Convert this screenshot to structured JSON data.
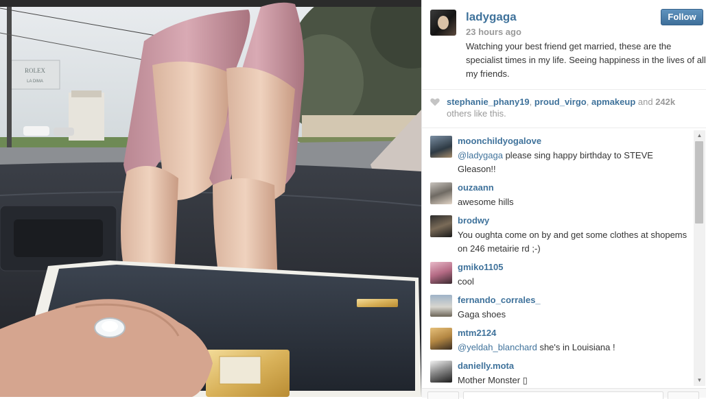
{
  "post": {
    "username": "ladygaga",
    "follow_label": "Follow",
    "timestamp": "23 hours ago",
    "caption": "Watching your best friend get married, these are the specialist times in my life. Seeing happiness in the lives of all my friends."
  },
  "likes": {
    "users": [
      "stephanie_phany19",
      "proud_virgo",
      "apmakeup"
    ],
    "sep1": ", ",
    "sep2": ", ",
    "and_text": " and ",
    "count": "242k",
    "suffix": " others like this."
  },
  "comments": [
    {
      "user": "moonchildyogalove",
      "mention": "@ladygaga",
      "text": " please sing happy birthday to STEVE Gleason!!"
    },
    {
      "user": "ouzaann",
      "mention": "",
      "text": "awesome hills"
    },
    {
      "user": "brodwy",
      "mention": "",
      "text": "You oughta come on by and get some clothes at shopems on 246 metairie rd ;-)"
    },
    {
      "user": "gmiko1105",
      "mention": "",
      "text": "cool"
    },
    {
      "user": "fernando_corrales_",
      "mention": "",
      "text": "Gaga shoes"
    },
    {
      "user": "mtm2124",
      "mention": "@yeldah_blanchard",
      "text": " she's in Louisiana !"
    },
    {
      "user": "danielly.mota",
      "mention": "",
      "text": "Mother Monster ▯"
    }
  ],
  "photo": {
    "sign_text": "ROLEX",
    "sign_subtext": "LA DIMA"
  },
  "colors": {
    "link": "#3f729b",
    "follow_button": "#4b7eab",
    "muted": "#999999"
  },
  "icons": {
    "like": "heart-icon",
    "scroll_up": "scroll-up-arrow",
    "scroll_down": "scroll-down-arrow"
  }
}
